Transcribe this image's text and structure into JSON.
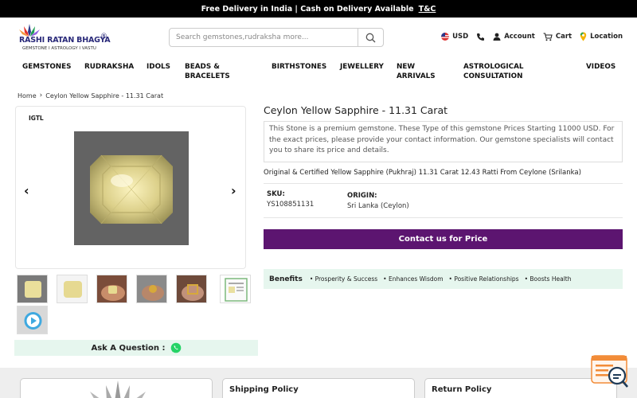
{
  "promo": {
    "text": "Free Delivery in India | Cash on Delivery Available",
    "link": "T&C"
  },
  "brand": {
    "name": "RASHI RATAN BHAGYA",
    "reg": "®",
    "tagline": "GEMSTONE I ASTROLOGY I VASTU"
  },
  "search": {
    "placeholder": "Search gemstones,rudraksha more..."
  },
  "header_actions": {
    "currency": "USD",
    "account": "Account",
    "cart": "Cart",
    "location": "Location"
  },
  "nav": [
    "GEMSTONES",
    "RUDRAKSHA",
    "IDOLS",
    "BEADS &\nBRACELETS",
    "BIRTHSTONES",
    "JEWELLERY",
    "NEW\nARRIVALS",
    "ASTROLOGICAL\nCONSULTATION",
    "VIDEOS"
  ],
  "breadcrumb": {
    "home": "Home",
    "current": "Ceylon Yellow Sapphire - 11.31 Carat"
  },
  "gallery": {
    "badge": "IGTL"
  },
  "ask_question": "Ask A Question :",
  "product": {
    "title": "Ceylon Yellow Sapphire - 11.31 Carat",
    "description": "This Stone is a premium gemstone. These Type of this gemstone Prices Starting 11000 USD. For the exact prices, please provide your contact information. Our gemstone specialists will contact you to share its price and details.",
    "subtitle": "Original & Certified Yellow Sapphire (Pukhraj) 11.31 Carat 12.43 Ratti From Ceylone (Srilanka)",
    "sku_label": "SKU:",
    "sku": "YS108851131",
    "origin_label": "ORIGIN:",
    "origin": "Sri Lanka (Ceylon)",
    "contact_button": "Contact us for Price"
  },
  "benefits": {
    "title": "Benefits",
    "items": [
      "Prosperity & Success",
      "Enhances Wisdom",
      "Positive Relationships",
      "Boosts Health"
    ]
  },
  "footer_cards": [
    "",
    "Shipping Policy",
    "Return Policy"
  ],
  "colors": {
    "accent": "#5c1570",
    "mint": "#e6f6ee",
    "topbar": "#000000"
  }
}
